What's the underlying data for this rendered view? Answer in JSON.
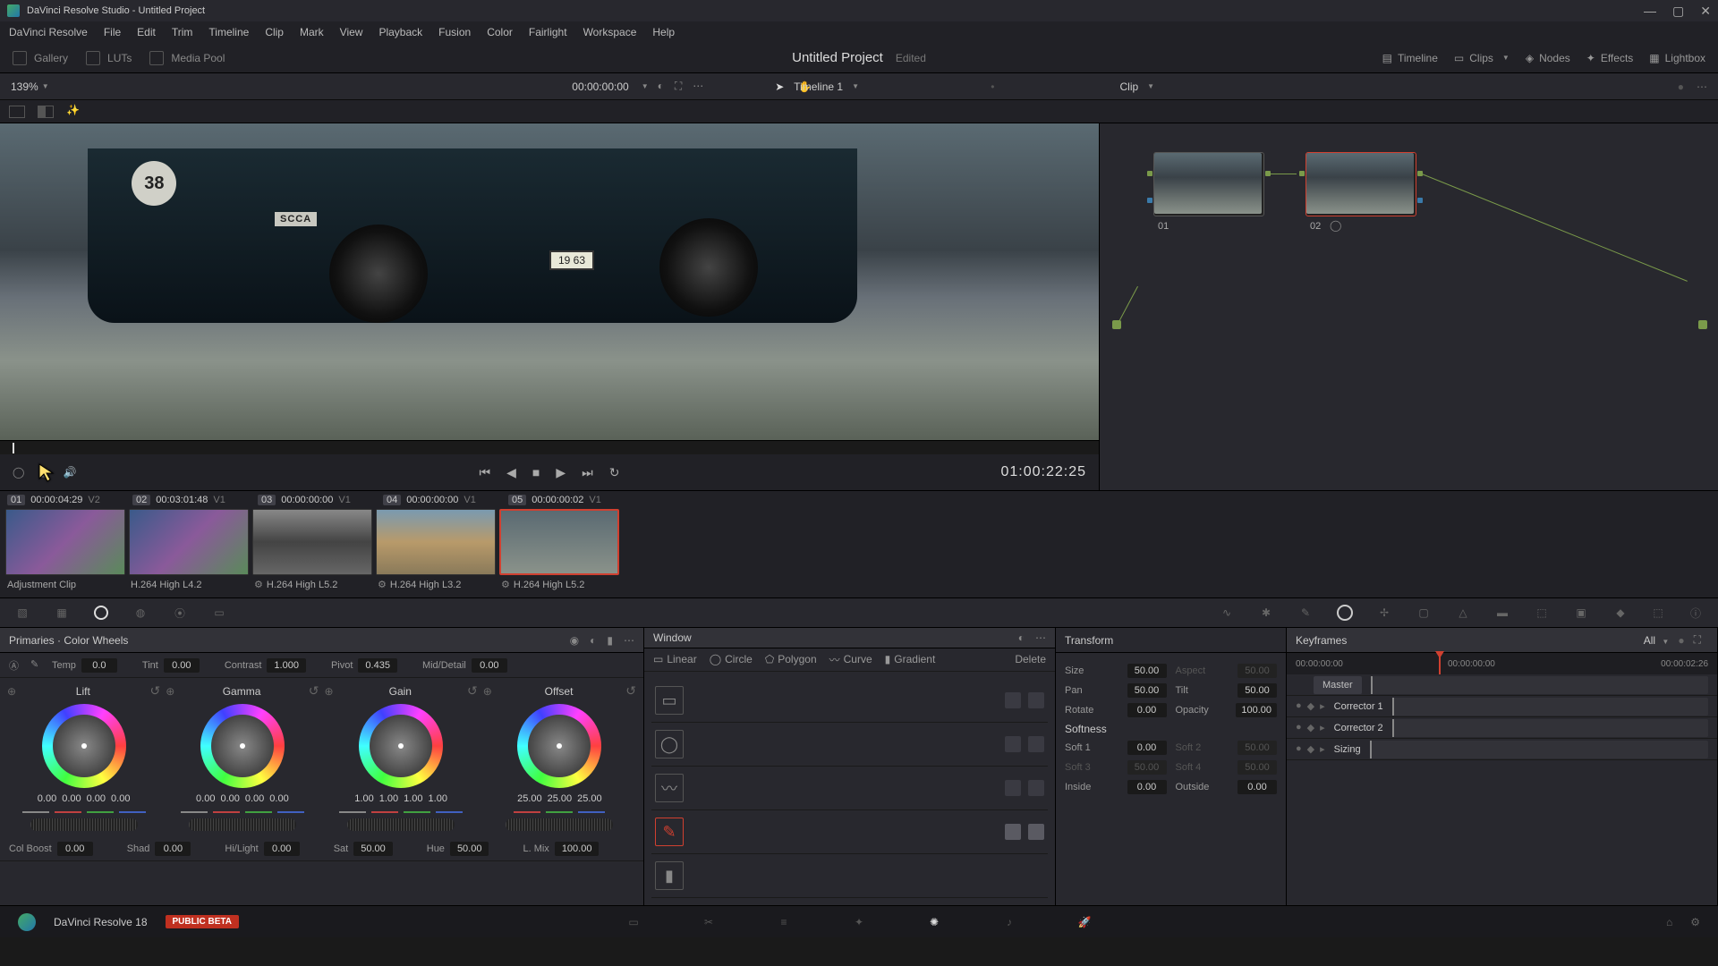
{
  "app": {
    "title": "DaVinci Resolve Studio - Untitled Project"
  },
  "menu": [
    "DaVinci Resolve",
    "File",
    "Edit",
    "Trim",
    "Timeline",
    "Clip",
    "Mark",
    "View",
    "Playback",
    "Fusion",
    "Color",
    "Fairlight",
    "Workspace",
    "Help"
  ],
  "topbar": {
    "gallery": "Gallery",
    "luts": "LUTs",
    "mediapool": "Media Pool",
    "timeline": "Timeline",
    "clips": "Clips",
    "nodes": "Nodes",
    "effects": "Effects",
    "lightbox": "Lightbox"
  },
  "project": {
    "name": "Untitled Project",
    "status": "Edited"
  },
  "secbar": {
    "zoom": "139%",
    "timeline": "Timeline 1",
    "tc": "00:00:00:00",
    "clip": "Clip"
  },
  "viewer": {
    "decal": "38",
    "scca": "SCCA",
    "plate": "19  63"
  },
  "transport": {
    "tc": "01:00:22:25"
  },
  "clips": [
    {
      "num": "01",
      "tc": "00:00:04:29",
      "trk": "V2",
      "name": "Adjustment Clip",
      "imgcls": ""
    },
    {
      "num": "02",
      "tc": "00:03:01:48",
      "trk": "V1",
      "name": "H.264 High L4.2",
      "imgcls": ""
    },
    {
      "num": "03",
      "tc": "00:00:00:00",
      "trk": "V1",
      "name": "H.264 High L5.2",
      "imgcls": "c3"
    },
    {
      "num": "04",
      "tc": "00:00:00:00",
      "trk": "V1",
      "name": "H.264 High L3.2",
      "imgcls": "c4"
    },
    {
      "num": "05",
      "tc": "00:00:00:02",
      "trk": "V1",
      "name": "H.264 High L5.2",
      "imgcls": "c5"
    }
  ],
  "nodes": {
    "n1": "01",
    "n2": "02"
  },
  "primaries": {
    "title": "Primaries · Color Wheels",
    "temp_l": "Temp",
    "temp_v": "0.0",
    "tint_l": "Tint",
    "tint_v": "0.00",
    "contrast_l": "Contrast",
    "contrast_v": "1.000",
    "pivot_l": "Pivot",
    "pivot_v": "0.435",
    "md_l": "Mid/Detail",
    "md_v": "0.00",
    "wheels": [
      {
        "name": "Lift",
        "vals": [
          "0.00",
          "0.00",
          "0.00",
          "0.00"
        ]
      },
      {
        "name": "Gamma",
        "vals": [
          "0.00",
          "0.00",
          "0.00",
          "0.00"
        ]
      },
      {
        "name": "Gain",
        "vals": [
          "1.00",
          "1.00",
          "1.00",
          "1.00"
        ]
      },
      {
        "name": "Offset",
        "vals": [
          "25.00",
          "25.00",
          "25.00"
        ]
      }
    ],
    "row2": {
      "colboost_l": "Col Boost",
      "colboost_v": "0.00",
      "shad_l": "Shad",
      "shad_v": "0.00",
      "hilight_l": "Hi/Light",
      "hilight_v": "0.00",
      "sat_l": "Sat",
      "sat_v": "50.00",
      "hue_l": "Hue",
      "hue_v": "50.00",
      "lmix_l": "L. Mix",
      "lmix_v": "100.00"
    }
  },
  "window": {
    "title": "Window",
    "shapes": {
      "linear": "Linear",
      "circle": "Circle",
      "polygon": "Polygon",
      "curve": "Curve",
      "gradient": "Gradient",
      "delete": "Delete"
    }
  },
  "transform": {
    "title": "Transform",
    "size_l": "Size",
    "size_v": "50.00",
    "aspect_l": "Aspect",
    "aspect_v": "50.00",
    "pan_l": "Pan",
    "pan_v": "50.00",
    "tilt_l": "Tilt",
    "tilt_v": "50.00",
    "rotate_l": "Rotate",
    "rotate_v": "0.00",
    "opacity_l": "Opacity",
    "opacity_v": "100.00",
    "softness": "Softness",
    "soft1_l": "Soft 1",
    "soft1_v": "0.00",
    "soft2_l": "Soft 2",
    "soft2_v": "50.00",
    "soft3_l": "Soft 3",
    "soft3_v": "50.00",
    "soft4_l": "Soft 4",
    "soft4_v": "50.00",
    "inside_l": "Inside",
    "inside_v": "0.00",
    "outside_l": "Outside",
    "outside_v": "0.00"
  },
  "keyframes": {
    "title": "Keyframes",
    "all": "All",
    "tc_start": "00:00:00:00",
    "tc_head": "00:00:00:00",
    "tc_end": "00:00:02:26",
    "master": "Master",
    "tracks": [
      "Corrector 1",
      "Corrector 2",
      "Sizing"
    ]
  },
  "pagebar": {
    "ver": "DaVinci Resolve 18",
    "beta": "PUBLIC BETA"
  }
}
